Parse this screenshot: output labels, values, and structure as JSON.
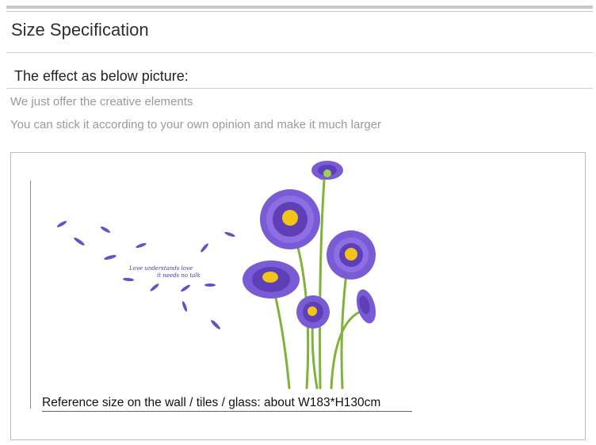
{
  "header": {
    "title": "Size Specification"
  },
  "section": {
    "subtitle": "The effect as below picture:",
    "notes": [
      "We just offer the creative elements",
      "You can stick it according to your own opinion and make it much larger"
    ]
  },
  "preview": {
    "artwork_text_line1": "Love understands love",
    "artwork_text_line2": "it needs no talk",
    "caption": "Reference size on the wall / tiles / glass: about W183*H130cm",
    "colors": {
      "petal": "#7a5bd6",
      "petal_dark": "#4a2f9e",
      "center": "#f2c418",
      "stem": "#7fb33a"
    }
  }
}
